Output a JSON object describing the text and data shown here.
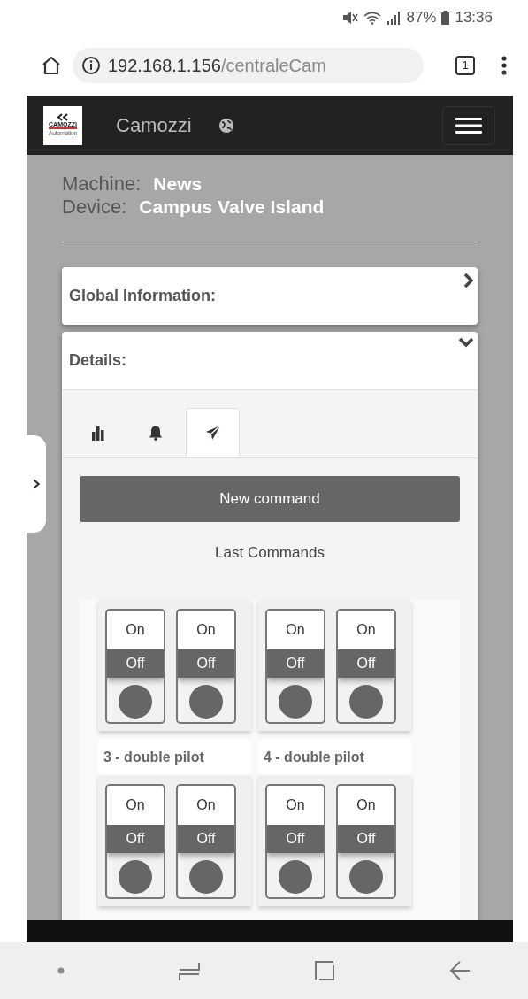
{
  "status_bar": {
    "battery": "87%",
    "time": "13:36"
  },
  "browser": {
    "url_host": "192.168.1.156",
    "url_path": "/centraleCam",
    "tab_count": "1"
  },
  "navbar": {
    "logo_text": "CAMOZZI",
    "logo_subtext": "Automation",
    "brand": "Camozzi"
  },
  "info": [
    {
      "label": "Machine:",
      "value": "News"
    },
    {
      "label": "Device:",
      "value": "Campus Valve Island"
    }
  ],
  "panels": [
    {
      "title": "Global Information:",
      "expanded": false
    },
    {
      "title": "Details:",
      "expanded": true
    }
  ],
  "tabs": [
    {
      "selected": false
    },
    {
      "selected": false
    },
    {
      "selected": true
    }
  ],
  "new_command_button": "New command",
  "last_commands_title": "Last Commands",
  "command_groups": [
    {
      "switches": [
        {
          "on_label": "On",
          "off_label": "Off",
          "on": false
        },
        {
          "on_label": "On",
          "off_label": "Off",
          "on": false
        }
      ]
    },
    {
      "switches": [
        {
          "on_label": "On",
          "off_label": "Off",
          "on": false
        },
        {
          "on_label": "On",
          "off_label": "Off",
          "on": false
        }
      ]
    },
    {
      "label": "3 - double pilot",
      "switches": [
        {
          "on_label": "On",
          "off_label": "Off",
          "on": false
        },
        {
          "on_label": "On",
          "off_label": "Off",
          "on": false
        }
      ]
    },
    {
      "label": "4 - double pilot",
      "switches": [
        {
          "on_label": "On",
          "off_label": "Off",
          "on": false
        },
        {
          "on_label": "On",
          "off_label": "Off",
          "on": false
        }
      ]
    }
  ]
}
